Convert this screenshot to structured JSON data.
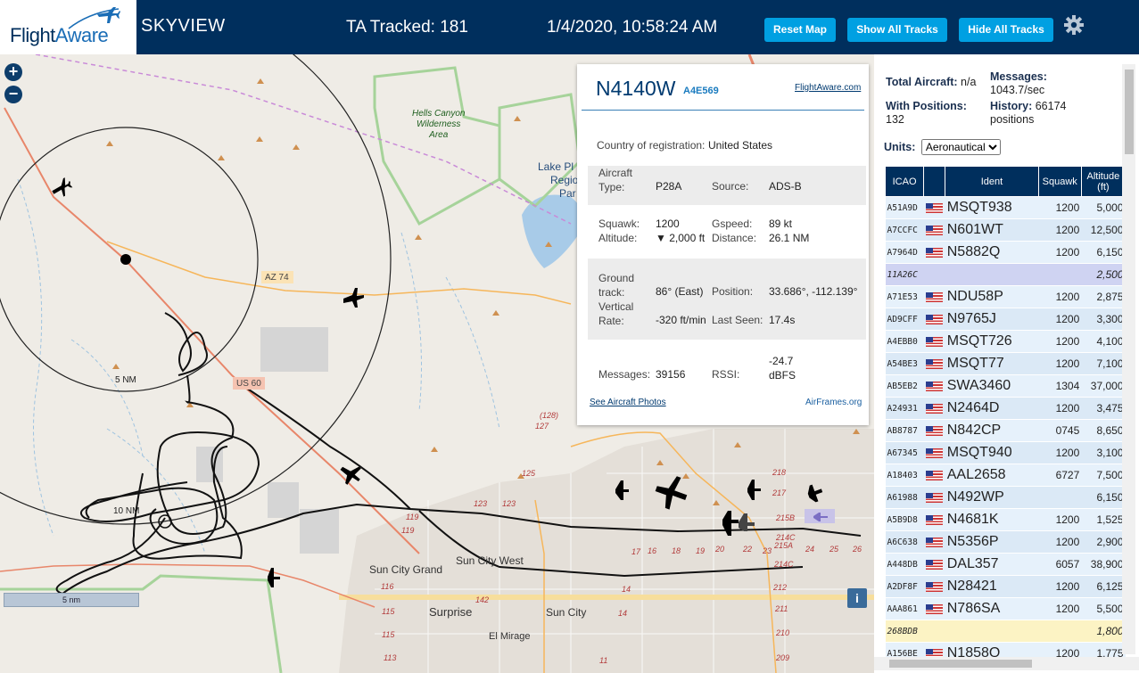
{
  "header": {
    "logo_main": "Flight",
    "logo_accent": "Aware",
    "app_title": "SKYVIEW",
    "tracked": "TA Tracked: 181",
    "clock": "1/4/2020, 10:58:24 AM",
    "reset_map": "Reset Map",
    "show_all": "Show All Tracks",
    "hide_all": "Hide All Tracks",
    "settings_icon": "gear-icon"
  },
  "map": {
    "zoom_in": "+",
    "zoom_out": "−",
    "scale": "5 nm",
    "ring_5": "5 NM",
    "ring_10": "10 NM",
    "info": "i",
    "labels": {
      "hells_canyon": [
        "Hells Canyon",
        "Wilderness",
        "Area"
      ],
      "lake_pleasant": [
        "Lake Pl",
        "Regio",
        "Par"
      ],
      "az74": "AZ 74",
      "us60": "US 60",
      "sun_city_grand": "Sun City Grand",
      "sun_city_west": "Sun City West",
      "surprise": "Surprise",
      "sun_city": "Sun City",
      "el_mirage": "El Mirage",
      "road_numbers": [
        "(128)",
        "127",
        "125",
        "123",
        "123",
        "119",
        "119",
        "116",
        "115",
        "115",
        "113",
        "14",
        "14",
        "17",
        "16",
        "18",
        "19",
        "20",
        "22",
        "23",
        "24",
        "25",
        "26",
        "215A",
        "214C",
        "214C",
        "215B",
        "212",
        "211",
        "210",
        "209",
        "218",
        "217",
        "142",
        "11"
      ]
    }
  },
  "popup": {
    "registration": "N4140W",
    "hex": "A4E569",
    "fa_link": "FlightAware.com",
    "country_label": "Country of registration:",
    "country": "United States",
    "aircraft_type_label": [
      "Aircraft",
      "Type:"
    ],
    "aircraft_type": "P28A",
    "source_label": "Source:",
    "source": "ADS-B",
    "squawk_label": "Squawk:",
    "squawk": "1200",
    "gspeed_label": "Gspeed:",
    "gspeed": "89 kt",
    "altitude_label": "Altitude:",
    "altitude": "▼ 2,000 ft",
    "distance_label": "Distance:",
    "distance": "26.1 NM",
    "ground_track_label": [
      "Ground",
      "track:"
    ],
    "ground_track": "86° (East)",
    "position_label": "Position:",
    "position": "33.686°, -112.139°",
    "vertical_rate_label": [
      "Vertical",
      "Rate:"
    ],
    "vertical_rate": "-320 ft/min",
    "last_seen_label": "Last Seen:",
    "last_seen": "17.4s",
    "messages_label": "Messages:",
    "messages": "39156",
    "rssi_label": "RSSI:",
    "rssi": [
      "-24.7",
      "dBFS"
    ],
    "photos_link": "See Aircraft Photos",
    "airframes_link": "AirFrames.org"
  },
  "sidebar": {
    "total_label": "Total Aircraft:",
    "total": "n/a",
    "messages_label": "Messages:",
    "messages": "1043.7/sec",
    "positions_label": "With Positions:",
    "positions": "132",
    "history_label": "History:",
    "history": "66174",
    "history_unit": "positions",
    "units_label": "Units:",
    "units_value": "Aeronautical",
    "columns": [
      "ICAO",
      "",
      "Ident",
      "Squawk",
      "Altitude (ft)"
    ],
    "rows": [
      {
        "icao": "A51A9D",
        "flag": true,
        "ident": "MSQT938",
        "squawk": "1200",
        "alt": "5,000",
        "style": ""
      },
      {
        "icao": "A7CCFC",
        "flag": true,
        "ident": "N601WT",
        "squawk": "1200",
        "alt": "12,500",
        "style": "alt"
      },
      {
        "icao": "A7964D",
        "flag": true,
        "ident": "N5882Q",
        "squawk": "1200",
        "alt": "6,150",
        "style": ""
      },
      {
        "icao": "11A26C",
        "flag": false,
        "ident": "",
        "squawk": "",
        "alt": "2,500",
        "style": "sel"
      },
      {
        "icao": "A71E53",
        "flag": true,
        "ident": "NDU58P",
        "squawk": "1200",
        "alt": "2,875",
        "style": ""
      },
      {
        "icao": "AD9CFF",
        "flag": true,
        "ident": "N9765J",
        "squawk": "1200",
        "alt": "3,300",
        "style": "alt"
      },
      {
        "icao": "A4EBB0",
        "flag": true,
        "ident": "MSQT726",
        "squawk": "1200",
        "alt": "4,100",
        "style": ""
      },
      {
        "icao": "A54BE3",
        "flag": true,
        "ident": "MSQT77",
        "squawk": "1200",
        "alt": "7,100",
        "style": "alt"
      },
      {
        "icao": "AB5EB2",
        "flag": true,
        "ident": "SWA3460",
        "squawk": "1304",
        "alt": "37,000",
        "style": ""
      },
      {
        "icao": "A24931",
        "flag": true,
        "ident": "N2464D",
        "squawk": "1200",
        "alt": "3,475",
        "style": "alt"
      },
      {
        "icao": "AB8787",
        "flag": true,
        "ident": "N842CP",
        "squawk": "0745",
        "alt": "8,650",
        "style": ""
      },
      {
        "icao": "A67345",
        "flag": true,
        "ident": "MSQT940",
        "squawk": "1200",
        "alt": "3,100",
        "style": "alt"
      },
      {
        "icao": "A18403",
        "flag": true,
        "ident": "AAL2658",
        "squawk": "6727",
        "alt": "7,500",
        "style": ""
      },
      {
        "icao": "A61988",
        "flag": true,
        "ident": "N492WP",
        "squawk": "",
        "alt": "6,150",
        "style": "alt"
      },
      {
        "icao": "A5B9D8",
        "flag": true,
        "ident": "N4681K",
        "squawk": "1200",
        "alt": "1,525",
        "style": ""
      },
      {
        "icao": "A6C638",
        "flag": true,
        "ident": "N5356P",
        "squawk": "1200",
        "alt": "2,900",
        "style": "alt"
      },
      {
        "icao": "A448DB",
        "flag": true,
        "ident": "DAL357",
        "squawk": "6057",
        "alt": "38,900",
        "style": ""
      },
      {
        "icao": "A2DF8F",
        "flag": true,
        "ident": "N28421",
        "squawk": "1200",
        "alt": "6,125",
        "style": "alt"
      },
      {
        "icao": "AAA861",
        "flag": true,
        "ident": "N786SA",
        "squawk": "1200",
        "alt": "5,500",
        "style": ""
      },
      {
        "icao": "268BDB",
        "flag": false,
        "ident": "",
        "squawk": "",
        "alt": "1,800",
        "style": "hl"
      },
      {
        "icao": "A156BE",
        "flag": true,
        "ident": "N1858Q",
        "squawk": "1200",
        "alt": "1,775",
        "style": ""
      }
    ]
  },
  "colors": {
    "header_bg": "#002f5d",
    "button_bg": "#00a0e2",
    "table_header": "#002f5d",
    "selected_row": "#cfd3f2",
    "highlight_row": "#fcf3c4"
  }
}
